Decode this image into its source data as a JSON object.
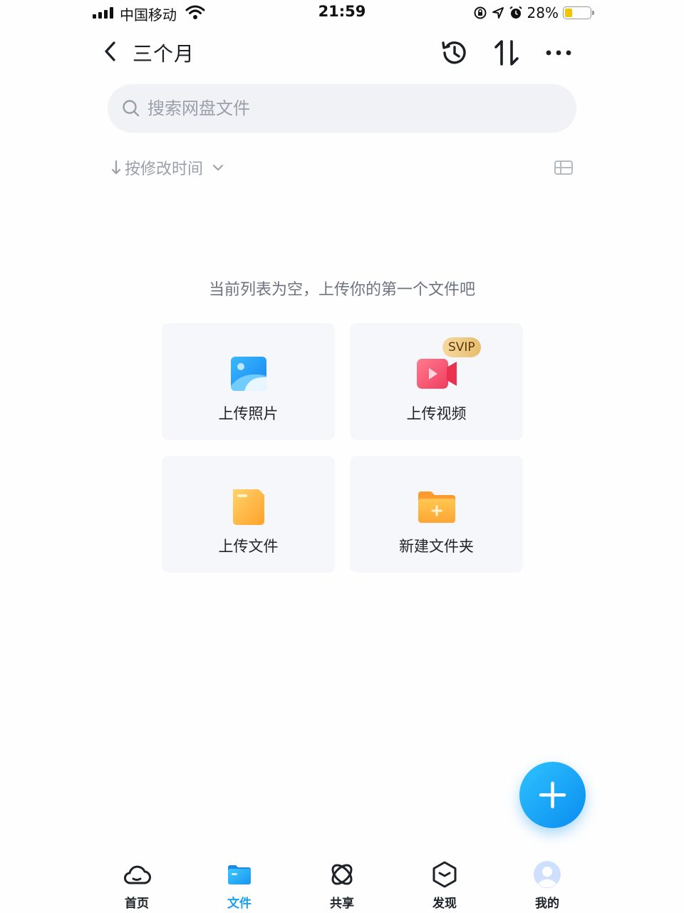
{
  "status_bar": {
    "carrier": "中国移动",
    "time": "21:59",
    "battery_percent": "28%",
    "battery_level": 0.28,
    "icons": [
      "signal-icon",
      "wifi-icon",
      "rotation-lock-icon",
      "location-icon",
      "alarm-icon",
      "battery-icon"
    ]
  },
  "header": {
    "title": "三个月",
    "icons": [
      "back-icon",
      "history-icon",
      "transfer-icon",
      "more-icon"
    ]
  },
  "search": {
    "placeholder": "搜索网盘文件",
    "value": ""
  },
  "sort": {
    "label": "按修改时间",
    "direction_icon": "arrow-down-icon",
    "view_icon": "list-view-icon"
  },
  "empty_state": {
    "message": "当前列表为空，上传你的第一个文件吧",
    "actions": [
      {
        "label": "上传照片",
        "icon": "photo-icon"
      },
      {
        "label": "上传视频",
        "icon": "video-icon",
        "badge": "SVIP"
      },
      {
        "label": "上传文件",
        "icon": "file-icon"
      },
      {
        "label": "新建文件夹",
        "icon": "new-folder-icon"
      }
    ]
  },
  "fab": {
    "icon": "plus-icon"
  },
  "bottom_nav": {
    "items": [
      {
        "label": "首页",
        "icon": "cloud-icon",
        "active": false
      },
      {
        "label": "文件",
        "icon": "folder-icon",
        "active": true
      },
      {
        "label": "共享",
        "icon": "share-icon",
        "active": false
      },
      {
        "label": "发现",
        "icon": "discover-icon",
        "active": false
      },
      {
        "label": "我的",
        "icon": "avatar-icon",
        "active": false
      }
    ]
  },
  "colors": {
    "accent": "#1aa0f0",
    "search_bg": "#f0f2f6",
    "card_bg": "#f6f7fa",
    "svip_badge": "#e8bd6e"
  }
}
